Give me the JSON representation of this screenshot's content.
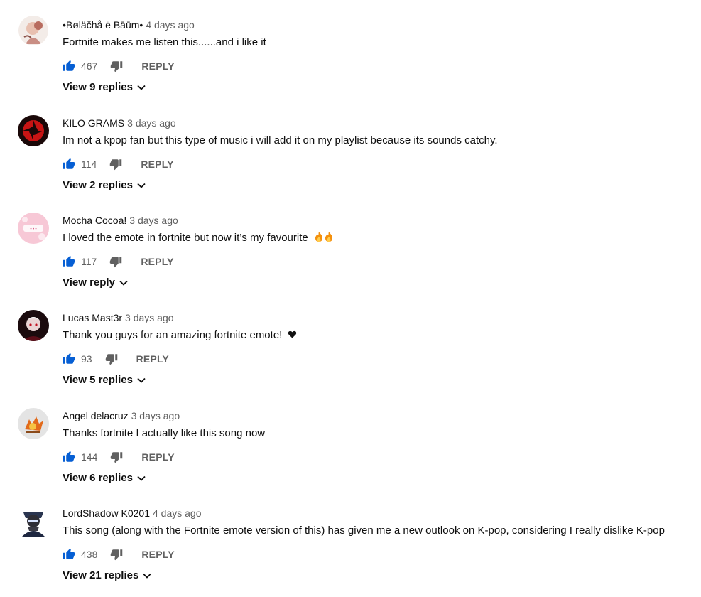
{
  "comments": [
    {
      "author": "•Bøläčhå ë Bāūm•",
      "time": "4 days ago",
      "text": "Fortnite makes me listen this......and i like it",
      "likes": "467",
      "reply_label": "REPLY",
      "view_replies": "View 9 replies"
    },
    {
      "author": "KILO GRAMS",
      "time": "3 days ago",
      "text": "Im not a kpop fan but this type of music i will add it on my playlist because its sounds catchy.",
      "likes": "114",
      "reply_label": "REPLY",
      "view_replies": "View 2 replies"
    },
    {
      "author": "Mocha Cocoa!",
      "time": "3 days ago",
      "text": "I loved the emote in fortnite but now it’s my favourite",
      "likes": "117",
      "reply_label": "REPLY",
      "view_replies": "View reply"
    },
    {
      "author": "Lucas Mast3r",
      "time": "3 days ago",
      "text": "Thank you guys for an amazing fortnite emote!",
      "likes": "93",
      "reply_label": "REPLY",
      "view_replies": "View 5 replies"
    },
    {
      "author": "Angel delacruz",
      "time": "3 days ago",
      "text": "Thanks fortnite I actually like this song now",
      "likes": "144",
      "reply_label": "REPLY",
      "view_replies": "View 6 replies"
    },
    {
      "author": "LordShadow K0201",
      "time": "4 days ago",
      "text": "This song (along with the Fortnite emote version of this) has given me a new outlook on K-pop, considering I really dislike K-pop",
      "likes": "438",
      "reply_label": "REPLY",
      "view_replies": "View 21 replies"
    }
  ],
  "icons": {
    "like": "thumbs-up-icon",
    "dislike": "thumbs-down-icon",
    "expand": "chevron-down-icon",
    "fire": "fire-emoji",
    "heart": "black-heart-emoji"
  },
  "colors": {
    "like_active": "#065fd4",
    "muted": "#606060",
    "text": "#0f0f0f"
  }
}
